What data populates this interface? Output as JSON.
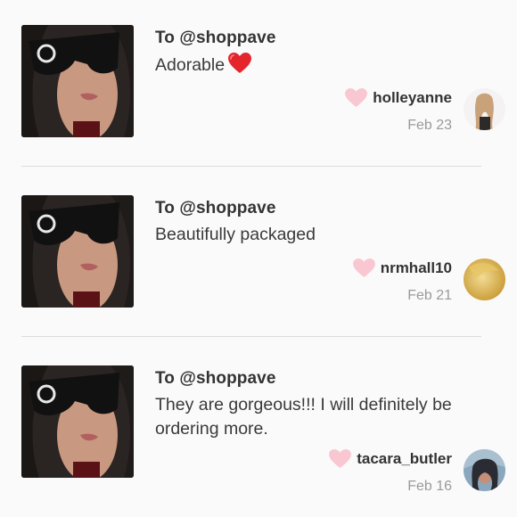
{
  "comments": [
    {
      "recipient": "To @shoppave",
      "text": "Adorable",
      "has_heart_emoji": true,
      "username": "holleyanne",
      "date": "Feb 23",
      "avatar_colors": [
        "#f4f2f3",
        "#c9a27a"
      ]
    },
    {
      "recipient": "To @shoppave",
      "text": "Beautifully packaged",
      "has_heart_emoji": false,
      "username": "nrmhall10",
      "date": "Feb 21",
      "avatar_colors": [
        "#d9b24a",
        "#efd584"
      ]
    },
    {
      "recipient": "To @shoppave",
      "text": "They are gorgeous!!! I will definitely be ordering more.",
      "has_heart_emoji": false,
      "username": "tacara_butler",
      "date": "Feb 16",
      "avatar_colors": [
        "#6f8fa8",
        "#2b2c33"
      ]
    }
  ],
  "colors": {
    "like_heart": "#f9c7d2",
    "emoji_heart": "#e5252c",
    "divider": "#dcdcdc",
    "date_text": "#9a9a9a"
  },
  "icons": {
    "like": "heart-outline-pink",
    "emoji": "red-heart"
  }
}
